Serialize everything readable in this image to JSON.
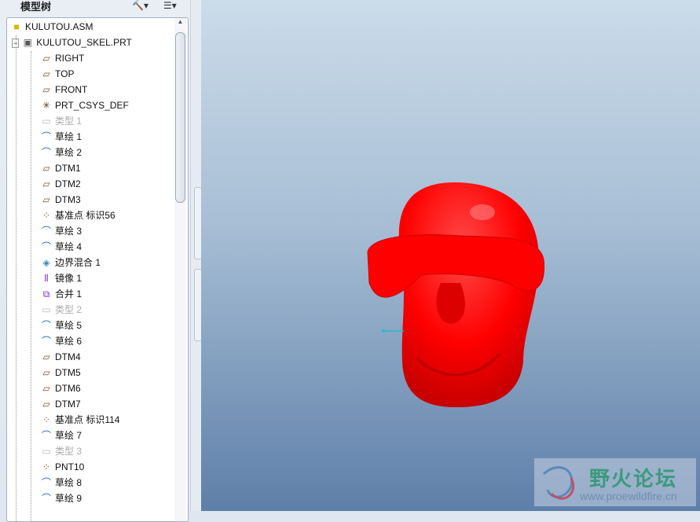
{
  "panel": {
    "title": "模型树",
    "tools_icon": "hammer-icon",
    "settings_icon": "list-icon"
  },
  "tree": {
    "root": "KULUTOU.ASM",
    "part": "KULUTOU_SKEL.PRT",
    "items": [
      {
        "label": "RIGHT",
        "icon": "plane"
      },
      {
        "label": "TOP",
        "icon": "plane"
      },
      {
        "label": "FRONT",
        "icon": "plane"
      },
      {
        "label": "PRT_CSYS_DEF",
        "icon": "csys"
      },
      {
        "label": "类型 1",
        "icon": "type",
        "gray": true
      },
      {
        "label": "草绘 1",
        "icon": "sketch"
      },
      {
        "label": "草绘 2",
        "icon": "sketch"
      },
      {
        "label": "DTM1",
        "icon": "plane"
      },
      {
        "label": "DTM2",
        "icon": "plane"
      },
      {
        "label": "DTM3",
        "icon": "plane"
      },
      {
        "label": "基准点 标识56",
        "icon": "point"
      },
      {
        "label": "草绘 3",
        "icon": "sketch"
      },
      {
        "label": "草绘 4",
        "icon": "sketch"
      },
      {
        "label": "边界混合 1",
        "icon": "boundary"
      },
      {
        "label": "镜像 1",
        "icon": "mirror"
      },
      {
        "label": "合并 1",
        "icon": "merge"
      },
      {
        "label": "类型 2",
        "icon": "type",
        "gray": true
      },
      {
        "label": "草绘 5",
        "icon": "sketch"
      },
      {
        "label": "草绘 6",
        "icon": "sketch"
      },
      {
        "label": "DTM4",
        "icon": "plane"
      },
      {
        "label": "DTM5",
        "icon": "plane"
      },
      {
        "label": "DTM6",
        "icon": "plane"
      },
      {
        "label": "DTM7",
        "icon": "plane"
      },
      {
        "label": "基准点 标识114",
        "icon": "point"
      },
      {
        "label": "草绘 7",
        "icon": "sketch"
      },
      {
        "label": "类型 3",
        "icon": "type",
        "gray": true
      },
      {
        "label": "PNT10",
        "icon": "point"
      },
      {
        "label": "草绘 8",
        "icon": "sketch"
      },
      {
        "label": "草绘 9",
        "icon": "sketch"
      }
    ]
  },
  "watermark": {
    "title": "野火论坛",
    "url": "www.proewildfire.cn"
  },
  "colors": {
    "model": "#ff0000"
  }
}
